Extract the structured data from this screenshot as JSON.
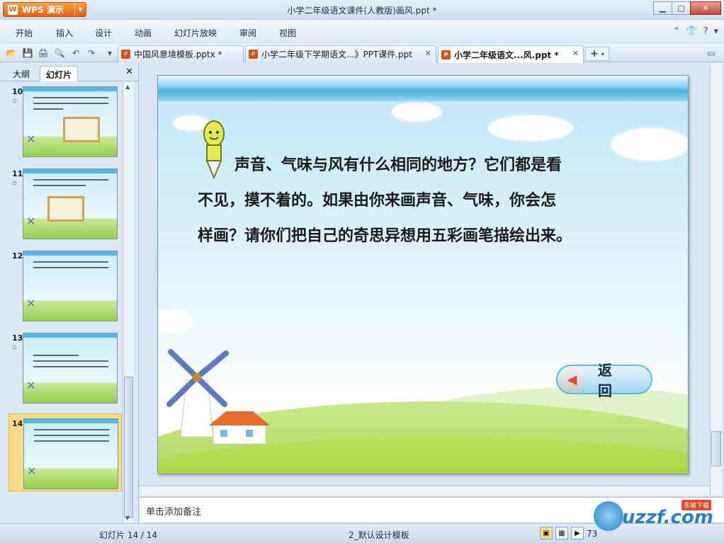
{
  "window": {
    "app_label": "WPS 演示",
    "title": "小学二年级语文课件(人教版)画风.ppt *"
  },
  "menu": [
    "开始",
    "插入",
    "设计",
    "动画",
    "幻灯片放映",
    "审阅",
    "视图"
  ],
  "doc_tabs": [
    {
      "label": "中国风意境模板.pptx *",
      "active": false
    },
    {
      "label": "小学二年级下学期语文...》PPT课件.ppt",
      "active": false
    },
    {
      "label": "小学二年级语文...风.ppt *",
      "active": true
    }
  ],
  "left_panel": {
    "tabs": [
      "大纲",
      "幻灯片"
    ],
    "active_tab": "幻灯片",
    "slides": [
      {
        "num": "10",
        "star": "☆"
      },
      {
        "num": "11",
        "star": "☆"
      },
      {
        "num": "12",
        "star": ""
      },
      {
        "num": "13",
        "star": "☆"
      },
      {
        "num": "14",
        "star": "",
        "selected": true
      }
    ]
  },
  "slide": {
    "text_line1": "声音、气味与风有什么相同的地方？它们都是看",
    "text_line2": "不见，摸不着的。如果由你来画声音、气味，你会怎",
    "text_line3": "样画？请你们把自己的奇思异想用五彩画笔描绘出来。",
    "back_button": "返 回"
  },
  "notes_placeholder": "单击添加备注",
  "status": {
    "slide_counter": "幻灯片 14 / 14",
    "template": "2_默认设计模板",
    "zoom": "73"
  },
  "watermark": {
    "text": "uzzf.com",
    "tag": "东坡下载"
  }
}
